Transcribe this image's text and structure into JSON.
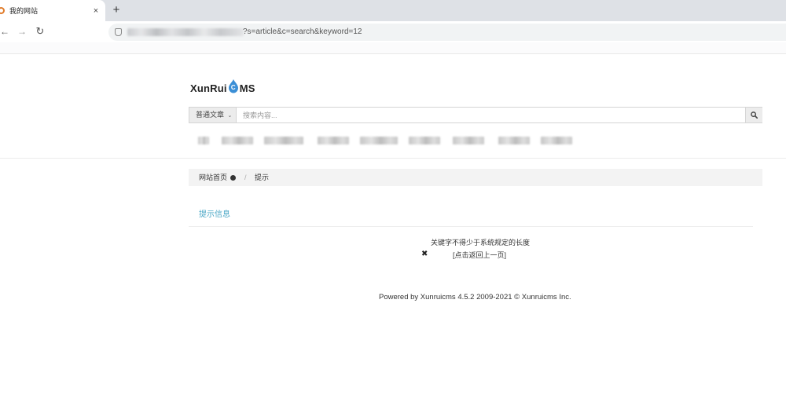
{
  "browser": {
    "tab_title": "我的网站",
    "tab_close": "×",
    "new_tab": "+",
    "url_visible": "?s=article&c=search&keyword=12",
    "back": "←",
    "forward": "→",
    "reload": "↻"
  },
  "site": {
    "logo_prefix": "XunRui",
    "logo_drop_letter": "C",
    "logo_suffix": "MS",
    "logo_color": "#3b8fd6"
  },
  "search": {
    "module_label": "普通文章",
    "caret": "⌄",
    "placeholder": "搜索内容..."
  },
  "breadcrumb": {
    "home": "网站首页",
    "separator": "/",
    "current": "提示"
  },
  "message": {
    "title": "提示信息",
    "text": "关键字不得少于系统规定的长度",
    "icon": "✖",
    "back_link": "[点击返回上一页]"
  },
  "footer": {
    "text": "Powered by Xunruicms 4.5.2 2009-2021 © Xunruicms Inc."
  },
  "colors": {
    "accent": "#4aa7c6",
    "breadcrumb_bg": "#f3f3f3"
  }
}
